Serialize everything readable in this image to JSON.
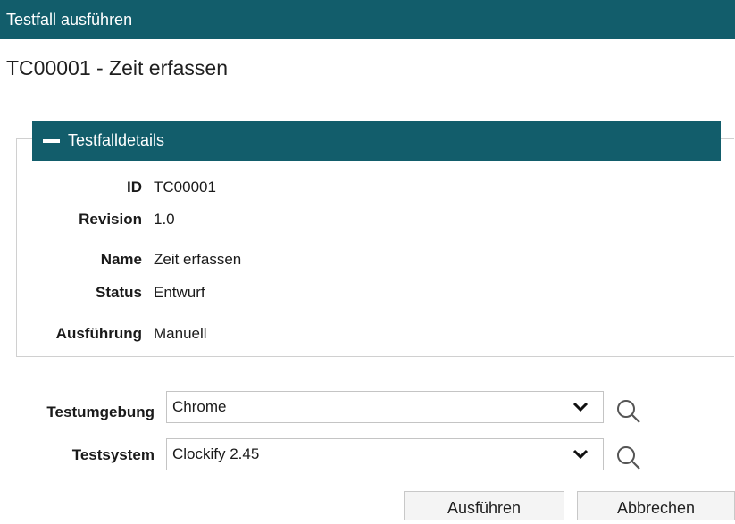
{
  "window": {
    "title": "Testfall ausführen"
  },
  "page": {
    "title": "TC00001 - Zeit erfassen"
  },
  "details": {
    "header": "Testfalldetails",
    "rows": [
      {
        "label": "ID",
        "value": "TC00001"
      },
      {
        "label": "Revision",
        "value": "1.0"
      },
      {
        "label": "Name",
        "value": "Zeit erfassen"
      },
      {
        "label": "Status",
        "value": "Entwurf"
      },
      {
        "label": "Ausführung",
        "value": "Manuell"
      }
    ]
  },
  "form": {
    "environment": {
      "label": "Testumgebung",
      "value": "Chrome"
    },
    "system": {
      "label": "Testsystem",
      "value": "Clockify 2.45"
    }
  },
  "buttons": {
    "execute": "Ausführen",
    "cancel": "Abbrechen"
  },
  "colors": {
    "header_bg": "#125d6b",
    "border": "#d0d0d0"
  },
  "icons": {
    "collapse": "minus-icon",
    "dropdown": "chevron-down-icon",
    "lookup": "search-icon"
  }
}
